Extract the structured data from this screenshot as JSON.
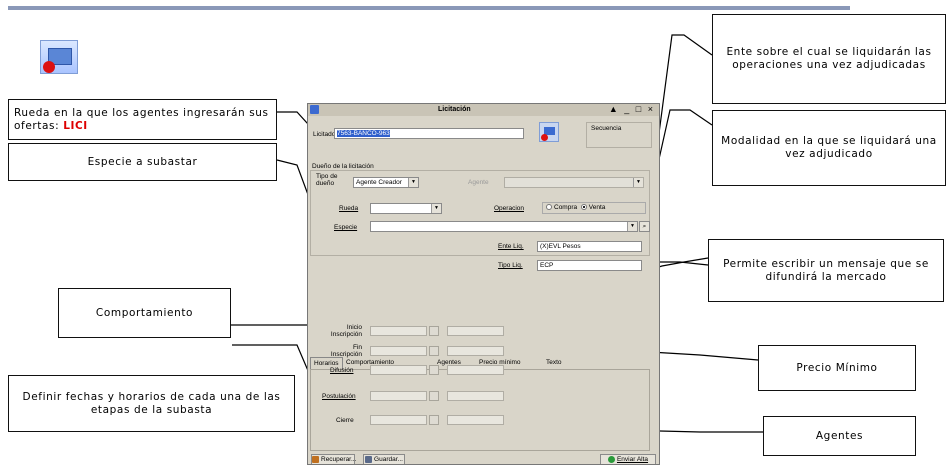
{
  "dialog": {
    "title": "Licitación",
    "window_controls": "▲ _ □ ×",
    "licitador_label": "Licitador",
    "licitador_value": "7563-BANCO-963",
    "secuencia_label": "Secuencia",
    "dueno_group": "Dueño de la licitación",
    "tipo_dueno_label": "Tipo de dueño",
    "tipo_dueno_value": "Agente Creador",
    "agente_label": "Agente",
    "rueda_label": "Rueda",
    "operacion_label": "Operacion",
    "compra_label": "Compra",
    "venta_label": "Venta",
    "especie_label": "Especie",
    "ente_liq_label": "Ente Liq.",
    "ente_liq_value": "(X)EVL Pesos",
    "tipo_liq_label": "Tipo Liq.",
    "tipo_liq_value": "ECP",
    "tabs": [
      "Horarios",
      "Comportamiento",
      "Agentes",
      "Precio mínimo",
      "Texto"
    ],
    "schedule_rows": [
      "Inicio Inscripción",
      "Fin Inscripción",
      "Difusión",
      "Postulación",
      "Cierre"
    ],
    "recuperar_label": "Recuperar...",
    "guardar_label": "Guardar...",
    "enviar_label": "Enviar Alta"
  },
  "callouts": {
    "rueda_pre": "Rueda en la que los agentes ingresarán sus ofertas: ",
    "rueda_highlight": "LICI",
    "especie": "Especie a subastar",
    "comportamiento": "Comportamiento",
    "fechas": "Definir fechas y horarios de cada una de las etapas de la subasta",
    "ente": "Ente sobre el cual se liquidarán las operaciones una vez adjudicadas",
    "modalidad": "Modalidad en la que se liquidará una vez adjudicado",
    "mensaje": "Permite escribir un mensaje que se difundirá la mercado",
    "precio": "Precio Mínimo",
    "agentes": "Agentes"
  },
  "colors": {
    "highlight": "#d00000",
    "selection": "#2f5fcc",
    "dialog_bg": "#d9d5c9"
  }
}
